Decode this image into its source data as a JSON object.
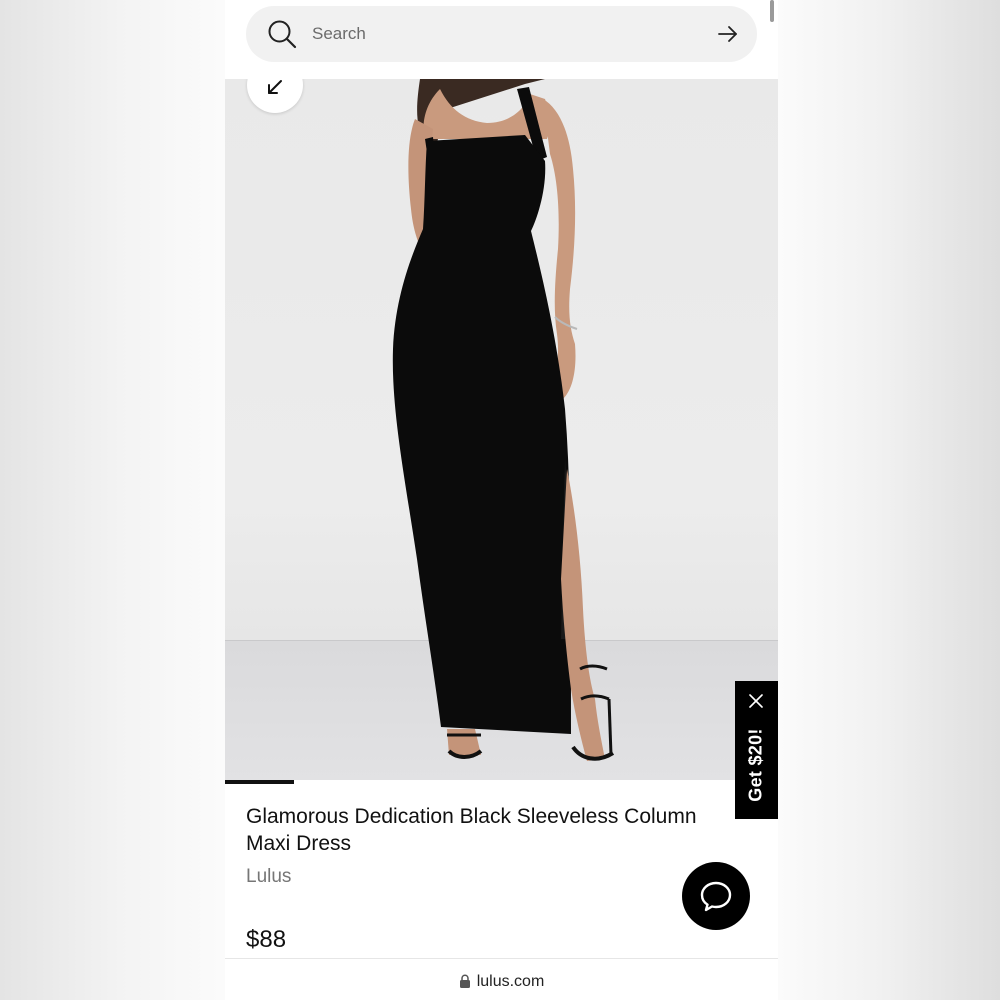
{
  "search": {
    "placeholder": "Search",
    "icon": "search-icon",
    "submit_icon": "arrow-right-icon"
  },
  "gallery": {
    "collapse_icon": "arrow-down-left-icon",
    "image_alt": "Model wearing black sleeveless column maxi dress",
    "progress_fraction": 0.125
  },
  "promo": {
    "label": "Get $20!",
    "close_icon": "close-icon"
  },
  "product": {
    "title": "Glamorous Dedication Black Sleeveless Column Maxi Dress",
    "brand": "Lulus",
    "price": "$88"
  },
  "chat": {
    "icon": "chat-bubble-icon"
  },
  "browser": {
    "url": "lulus.com",
    "lock_icon": "lock-icon"
  },
  "colors": {
    "accent": "#000000",
    "dress": "#0b0b0b",
    "skin": "#c99a7e",
    "background": "#ffffff"
  }
}
